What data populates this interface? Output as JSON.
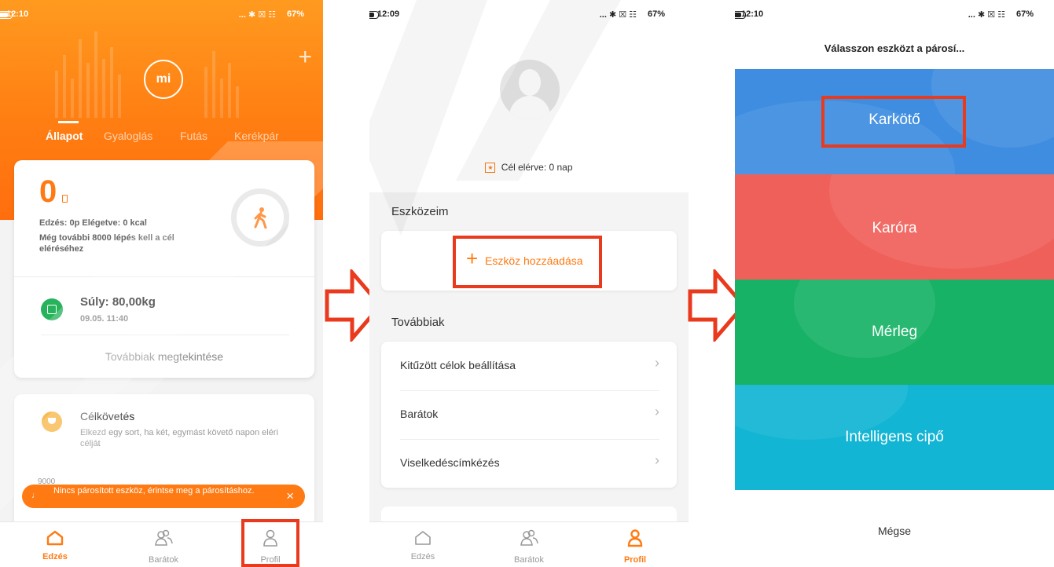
{
  "screen1": {
    "time": "12:10",
    "status_icons": "... ✱ ☒ ☷",
    "battery": "67%",
    "logo_text": "mi",
    "plus": "+",
    "tabs": [
      {
        "label": "Állapot"
      },
      {
        "label": "Gyaloglás"
      },
      {
        "label": "Futás"
      },
      {
        "label": "Kerékpár"
      }
    ],
    "steps_value": "0",
    "workout_line": "Edzés: 0p Elégetve: 0 kcal",
    "remaining_line": "Még további 8000 lépés kell a cél eléréséhez",
    "weight_label": "Súly: 80,00kg",
    "weight_time": "09.05. 11:40",
    "more_link": "Továbbiak megtekintése",
    "goal_title": "Célkövetés",
    "goal_desc": "Elkezd egy sort, ha két, egymást követő napon eléri célját",
    "chart_tick": "9000",
    "toast": "Nincs párosított eszköz, érintse meg a párosításhoz.",
    "toast_close": "×",
    "nav": [
      {
        "label": "Edzés"
      },
      {
        "label": "Barátok"
      },
      {
        "label": "Profil"
      }
    ]
  },
  "screen2": {
    "time": "12:09",
    "status_icons": "... ✱ ☒ ☷",
    "battery": "67%",
    "goal_reached": "Cél elérve: 0 nap",
    "devices_header": "Eszközeim",
    "add_device_plus": "+",
    "add_device": "Eszköz hozzáadása",
    "more_header": "Továbbiak",
    "menu": [
      {
        "label": "Kitűzött célok beállítása"
      },
      {
        "label": "Barátok"
      },
      {
        "label": "Viselkedéscímkézés"
      }
    ],
    "chevron": "›",
    "nav": [
      {
        "label": "Edzés"
      },
      {
        "label": "Barátok"
      },
      {
        "label": "Profil"
      }
    ]
  },
  "screen3": {
    "time": "12:10",
    "status_icons": "... ✱ ☒ ☷",
    "battery": "67%",
    "title": "Válasszon eszközt a párosí...",
    "options": [
      {
        "label": "Karkötő"
      },
      {
        "label": "Karóra"
      },
      {
        "label": "Mérleg"
      },
      {
        "label": "Intelligens cipő"
      }
    ],
    "cancel": "Mégse"
  },
  "colors": {
    "orange": "#ff7a12",
    "highlight_red": "#ea3a1e",
    "option_blue": "#3f8de0",
    "option_red": "#f0605a",
    "option_green": "#17b266",
    "option_teal": "#12b5d3"
  }
}
